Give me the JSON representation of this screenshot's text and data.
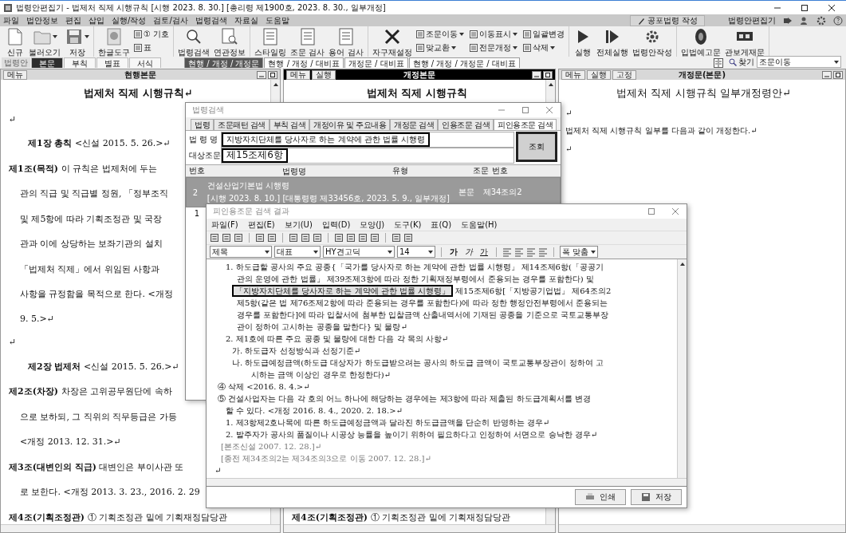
{
  "window": {
    "title": "법령안편집기 - 법제처 직제 시행규칙 [시행 2023. 8. 30.] [총리령 제1900호, 2023. 8. 30., 일부개정]"
  },
  "menu": [
    "파일",
    "법안정보",
    "편집",
    "삽입",
    "실행/작성",
    "검토/검사",
    "법령검색",
    "자료실",
    "도움말"
  ],
  "menu_right": {
    "publish_button": "공포법령 작성",
    "app_name": "법령안편집기"
  },
  "toolbar": [
    {
      "items": [
        {
          "kind": "large",
          "label": "신규",
          "dropdown": false
        },
        {
          "kind": "large",
          "label": "불러오기",
          "dropdown": true
        },
        {
          "kind": "large",
          "label": "저장",
          "dropdown": true
        }
      ]
    },
    {
      "items": [
        {
          "kind": "large",
          "label": "한글도구",
          "dropdown": false
        },
        {
          "kind": "small",
          "label": "① 기호",
          "dropdown": false
        },
        {
          "kind": "small",
          "label": "표",
          "dropdown": false
        }
      ]
    },
    {
      "items": [
        {
          "kind": "large",
          "label": "법령검색",
          "dropdown": false
        },
        {
          "kind": "large",
          "label": "연관정보",
          "dropdown": false
        }
      ]
    },
    {
      "items": [
        {
          "kind": "large",
          "label": "스타일링",
          "dropdown": false
        },
        {
          "kind": "large",
          "label": "조문 검사",
          "dropdown": false
        },
        {
          "kind": "large",
          "label": "용어 검사",
          "dropdown": false
        }
      ]
    },
    {
      "items": [
        {
          "kind": "large",
          "label": "자구재설정",
          "dropdown": false
        },
        {
          "kind": "small",
          "label": "조문이동",
          "dropdown": true
        },
        {
          "kind": "small",
          "label": "맞교환",
          "dropdown": true
        },
        {
          "kind": "small",
          "label": "이동표시",
          "dropdown": true
        },
        {
          "kind": "small",
          "label": "전문개정",
          "dropdown": true
        },
        {
          "kind": "small",
          "label": "일괄변경",
          "dropdown": false
        },
        {
          "kind": "small",
          "label": "삭제",
          "dropdown": true
        }
      ]
    },
    {
      "items": [
        {
          "kind": "large",
          "label": "실행",
          "dropdown": false
        },
        {
          "kind": "large",
          "label": "전체실행",
          "dropdown": false
        },
        {
          "kind": "large",
          "label": "법령안작성",
          "dropdown": false
        }
      ]
    },
    {
      "items": [
        {
          "kind": "large",
          "label": "입법예고문",
          "dropdown": false
        },
        {
          "kind": "large",
          "label": "관보게재문",
          "dropdown": false
        }
      ]
    }
  ],
  "doc_label": "법령안",
  "doc_tabs": [
    {
      "label": "본문",
      "selected": true
    },
    {
      "label": "부칙",
      "selected": false
    },
    {
      "label": "별표",
      "selected": false
    },
    {
      "label": "서식",
      "selected": false
    }
  ],
  "view_tabs": [
    {
      "label": "현행 / 개정 / 개정문",
      "selected": true
    },
    {
      "label": "현행 / 개정 / 대비표",
      "selected": false
    },
    {
      "label": "개정문 / 대비표",
      "selected": false
    },
    {
      "label": "현행 / 개정 / 개정문 / 대비표",
      "selected": false
    }
  ],
  "find": {
    "label": "찾기",
    "value": "조문이동"
  },
  "panes": [
    {
      "title": "현행본문",
      "active": false,
      "buttons": [
        "메뉴"
      ],
      "lines": [
        {
          "kind": "title",
          "text": "법제처 직제 시행규칙↵"
        },
        {
          "kind": "blank",
          "text": "↵"
        },
        {
          "kind": "chapter",
          "text": "**제1장 총칙** <신설 2015. 5. 26.>↵"
        },
        {
          "kind": "article",
          "text": "**제1조(목적)** 이 규칙은 법제처에 두는"
        },
        {
          "kind": "cont",
          "text": "관의 직급 및 직급별 정원, 「정부조직"
        },
        {
          "kind": "cont",
          "text": "및 제5항에 따라 기획조정관 및 국장"
        },
        {
          "kind": "cont",
          "text": "관과 이에 상당하는 보좌기관의 설치"
        },
        {
          "kind": "cont",
          "text": "「법제처 직제」에서 위임된 사항과"
        },
        {
          "kind": "cont",
          "text": "사항을 규정함을 목적으로 한다. <개정"
        },
        {
          "kind": "cont",
          "text": "9. 5.>↵"
        },
        {
          "kind": "blank",
          "text": "↵"
        },
        {
          "kind": "chapter",
          "text": "**제2장 법제처** <신설 2015. 5. 26.>↵"
        },
        {
          "kind": "article",
          "text": "**제2조(차장)** 차장은 고위공무원단에 속하"
        },
        {
          "kind": "cont",
          "text": "으로 보하되, 그 직위의 직무등급은 가등"
        },
        {
          "kind": "cont",
          "text": "<개정 2013. 12. 31.>↵"
        },
        {
          "kind": "article",
          "text": "**제3조(대변인의 직급)** 대변인은 부이사관 또"
        },
        {
          "kind": "cont",
          "text": "로 보한다. <개정 2013. 3. 23., 2016. 2. 29"
        },
        {
          "kind": "article",
          "text": "**제4조(기획조정관)** ① 기획조정관 밑에 기획재정담당관"
        }
      ]
    },
    {
      "title": "개정본문",
      "active": true,
      "buttons": [
        "메뉴",
        "실행"
      ],
      "lines": [
        {
          "kind": "title",
          "text": "법제처 직제 시행규칙"
        },
        {
          "kind": "article",
          "text": "**제4조(기획조정관)** ① 기획조정관 밑에 기획재정담당관"
        }
      ]
    },
    {
      "title": "개정문(본문)",
      "active": false,
      "buttons": [
        "메뉴",
        "실행",
        "고정"
      ],
      "lines": [
        {
          "kind": "title",
          "text": "법제처 직제 시행규칙 일부개정령안↵"
        },
        {
          "kind": "blank",
          "text": "↵"
        },
        {
          "kind": "plain",
          "text": "법제처 직제 시행규칙 일부를 다음과 같이 개정한다.↵"
        },
        {
          "kind": "blank",
          "text": "↵"
        }
      ]
    }
  ],
  "law_search_dialog": {
    "title": "법령검색",
    "tabs": [
      {
        "label": "법령",
        "selected": false
      },
      {
        "label": "조문패턴 검색",
        "selected": false
      },
      {
        "label": "부칙 검색",
        "selected": false
      },
      {
        "label": "개정이유 및 주요내용",
        "selected": false
      },
      {
        "label": "개정문 검색",
        "selected": false
      },
      {
        "label": "인용조문 검색",
        "selected": false
      },
      {
        "label": "피인용조문 검색",
        "selected": true
      }
    ],
    "fields": [
      {
        "label": "법 령 명",
        "value": "지방자치단체를 당사자로 하는 계약에 관한 법률 시행령"
      },
      {
        "label": "대상조문",
        "value": "제15조제6항"
      }
    ],
    "search_button": "조회",
    "columns": [
      "번호",
      "법령명",
      "유형",
      "조문 번호"
    ],
    "rows": [
      {
        "number": "2",
        "law_name": "건설산업기본법 시행령",
        "law_detail": "[시행 2023. 8. 10.] [대통령령 제33456호, 2023. 5. 9., 일부개정]",
        "type": "본문",
        "article": "제34조의2",
        "selected": true
      },
      {
        "number": "1",
        "selected": false
      }
    ]
  },
  "result_dialog": {
    "title": "피인용조문 검색 결과",
    "menu": [
      "파일(F)",
      "편집(E)",
      "보기(U)",
      "입력(D)",
      "모양(J)",
      "도구(K)",
      "표(Q)",
      "도움말(H)"
    ],
    "format": {
      "style": "제목",
      "sub_style": "대표",
      "font": "HY견고딕",
      "size": "14",
      "char_buttons": [
        "가",
        "가",
        "가"
      ],
      "fit": "폭 맞춤"
    },
    "lines": [
      {
        "kind": "item",
        "text": "1. 하도급할 공사의 주요 공종{「국가를 당사자로 하는 계약에 관한 법률 시행령」 제14조제6항(「공공기"
      },
      {
        "kind": "cont",
        "text": "관의 운영에 관한 법률」 제39조제3항에 따라 정한 기획재정부령에서 준용되는 경우를 포함한다) 및"
      },
      {
        "kind": "cont",
        "highlight": "「지방자치단체를 당사자로 하는 계약에 관한 법률 시행령」",
        "text": "제15조제6항[「지방공기업법」 제64조의2"
      },
      {
        "kind": "cont",
        "text": "제5항(같은 법 제76조제2항에 따라 준용되는 경우를 포함한다)에 따라 정한 행정안전부령에서 준용되는"
      },
      {
        "kind": "cont",
        "text": "경우를 포함한다]에 따라 입찰서에 첨부한 입찰금액 산출내역서에 기재된 공종을 기준으로 국토교통부장"
      },
      {
        "kind": "cont",
        "text": "관이 정하여 고시하는 공종을 말한다} 및 물량↵"
      },
      {
        "kind": "item",
        "text": "2. 제1호에 따른 주요 공종 및 물량에 대한 다음 각 목의 사항↵"
      },
      {
        "kind": "sub",
        "text": "가. 하도급자 선정방식과 선정기준↵"
      },
      {
        "kind": "sub",
        "text": "나. 하도급예정금액(하도급 대상자가 하도급받으려는 공사의 하도급 금액이 국토교통부장관이 정하여 고"
      },
      {
        "kind": "subcont",
        "text": "시하는 금액 이상인 경우로 한정한다)↵"
      },
      {
        "kind": "para",
        "text": "④ 삭제 <2016. 8. 4.>↵"
      },
      {
        "kind": "para",
        "text": "⑤ 건설사업자는 다음 각 호의 어느 하나에 해당하는 경우에는 제3항에 따라 제출된 하도급계획서를 변경"
      },
      {
        "kind": "item",
        "text": "할 수 있다. <개정 2016. 8. 4., 2020. 2. 18.>↵"
      },
      {
        "kind": "item",
        "text": "1. 제3항제2호나목에 따른 하도급예정금액과 달라진 하도급금액을 단순히 반영하는 경우↵"
      },
      {
        "kind": "item",
        "text": "2. 발주자가 공사의 품질이나 시공상 능률을 높이기 위하여 필요하다고 인정하여 서면으로 승낙한 경우↵"
      },
      {
        "kind": "note",
        "text": "[본조신설 2007. 12. 28.]↵"
      },
      {
        "kind": "note",
        "text": "[종전 제34조의2는 제34조의3으로 이동 2007. 12. 28.]↵"
      },
      {
        "kind": "blank",
        "text": "↵"
      }
    ],
    "buttons": [
      "인쇄",
      "저장"
    ]
  }
}
